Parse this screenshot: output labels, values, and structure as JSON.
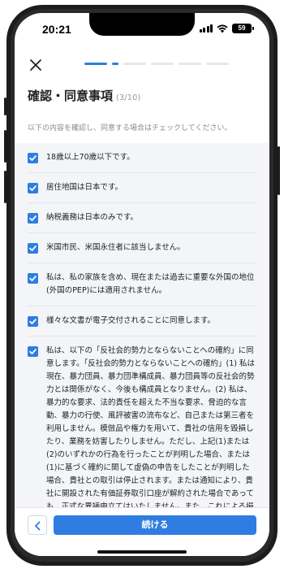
{
  "status_bar": {
    "time": "20:21",
    "battery": "59",
    "icons": [
      "cellular-signal-icon",
      "wifi-icon",
      "battery-icon"
    ]
  },
  "header": {
    "close_icon": "close-icon",
    "progress": {
      "total_segments": 6,
      "current_step": 3,
      "active_color": "#2f7de1"
    },
    "title": "確認・同意事項",
    "step": "(3/10)"
  },
  "intro": "以下の内容を確認し、同意する場合はチェックしてください。",
  "items": [
    {
      "checked": true,
      "text": "18歳以上70歳以下です。"
    },
    {
      "checked": true,
      "text": "居住地国は日本です。"
    },
    {
      "checked": true,
      "text": "納税義務は日本のみです。"
    },
    {
      "checked": true,
      "text": "米国市民、米国永住者に該当しません。"
    },
    {
      "checked": true,
      "text": "私は、私の家族を含め、現在または過去に重要な外国の地位(外国のPEP)には適用されません。"
    },
    {
      "checked": true,
      "text": "様々な文書が電子交付されることに同意します。"
    },
    {
      "checked": true,
      "text": "私は、以下の「反社会的勢力とならないことへの確約」に同意します。「反社会的勢力とならないことへの確約」(1) 私は現在、暴力団員、暴力団準構成員、暴力団員等の反社会的勢力とは関係がなく、今後も構成員となりません。(2) 私は、暴力的な要求、法的責任を超えた不当な要求、脅迫的な言動、暴力の行使、風評被害の流布など、自己または第三者を利用しません。模倣品や権力を用いて、貴社の信用を毀損したり、業務を妨害したりしません。ただし、上記(1)または(2)のいずれかの行為を行ったことが判明した場合、または(1)に基づく確約に関して虚偽の申告をしたことが判明した場合、貴社との取引は停止されます。または通知により、貴社に開設された有価証券取引口座が解約された場合であっても、正式な異議申立てはいたしません。また、これによる損害についても責任を負います。"
    }
  ],
  "footer": {
    "back_icon": "chevron-left-icon",
    "continue_label": "続ける"
  },
  "colors": {
    "accent": "#2f7de1",
    "list_background": "#f3f5f8"
  }
}
